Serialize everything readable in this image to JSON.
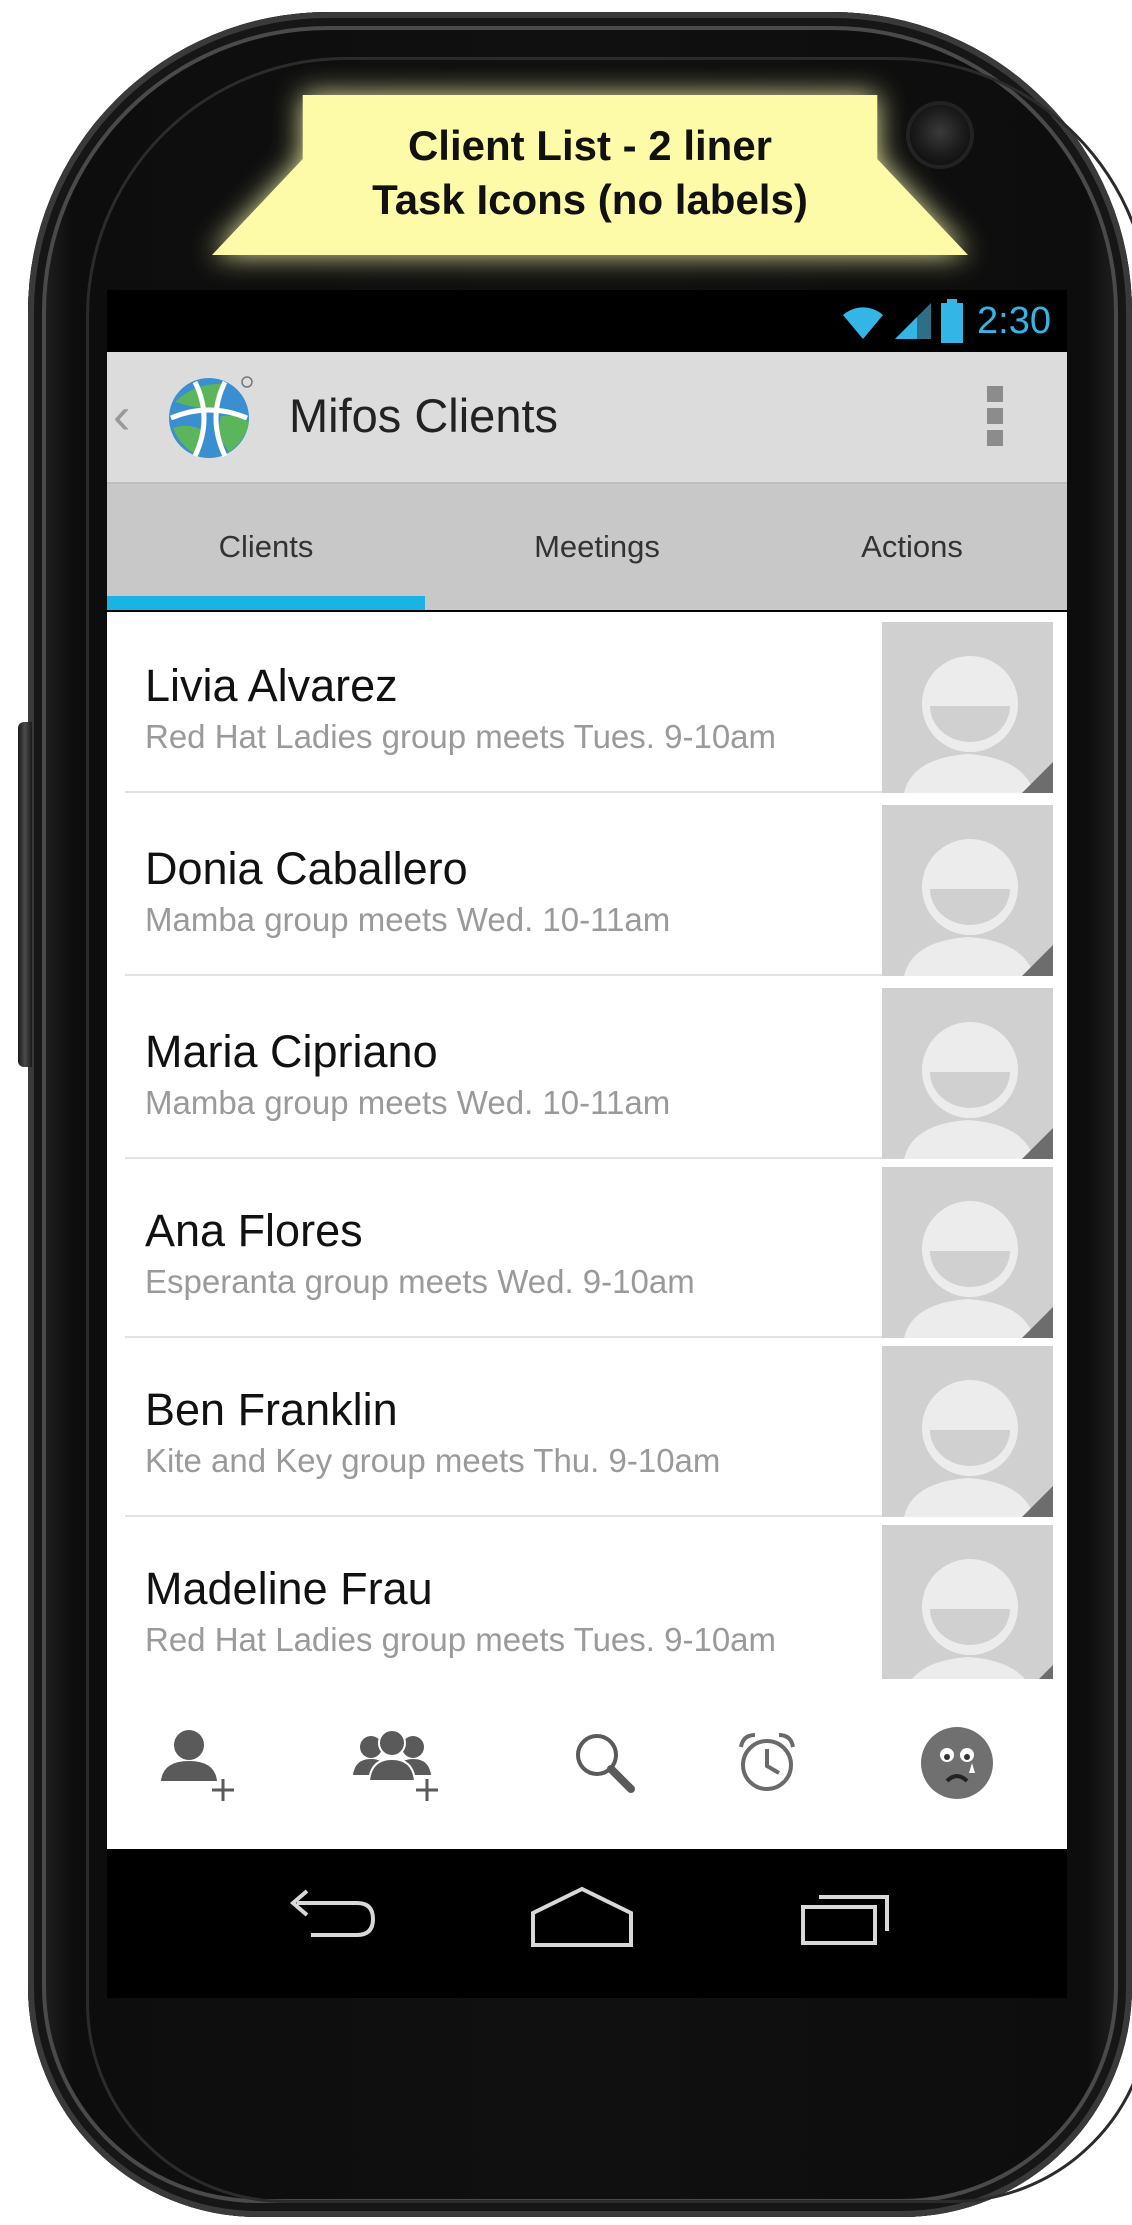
{
  "note": {
    "line1": "Client List - 2 liner",
    "line2": "Task Icons (no labels)"
  },
  "status_bar": {
    "time": "2:30",
    "icons": [
      "wifi-icon",
      "signal-icon",
      "battery-icon"
    ],
    "accent_color": "#33b5e5"
  },
  "action_bar": {
    "title": "Mifos Clients",
    "icons": [
      "up-caret-icon",
      "mifos-globe-logo",
      "overflow-menu-icon"
    ]
  },
  "tabs": [
    {
      "label": "Clients",
      "selected": true
    },
    {
      "label": "Meetings",
      "selected": false
    },
    {
      "label": "Actions",
      "selected": false
    }
  ],
  "tab_indicator_color": "#1ab3e6",
  "clients": [
    {
      "name": "Livia Alvarez",
      "subtitle": "Red Hat Ladies group meets Tues. 9-10am"
    },
    {
      "name": "Donia Caballero",
      "subtitle": "Mamba group meets Wed. 10-11am"
    },
    {
      "name": "Maria Cipriano",
      "subtitle": "Mamba group meets Wed. 10-11am"
    },
    {
      "name": "Ana Flores",
      "subtitle": "Esperanta group meets Wed. 9-10am"
    },
    {
      "name": "Ben Franklin",
      "subtitle": "Kite and Key group meets Thu. 9-10am"
    },
    {
      "name": "Madeline Frau",
      "subtitle": "Red Hat Ladies group meets Tues. 9-10am"
    }
  ],
  "bottom_actions": [
    "add-client-icon",
    "add-group-icon",
    "search-icon",
    "alarm-icon",
    "sad-face-icon"
  ],
  "nav_buttons": [
    "back-icon",
    "home-icon",
    "recent-apps-icon"
  ]
}
